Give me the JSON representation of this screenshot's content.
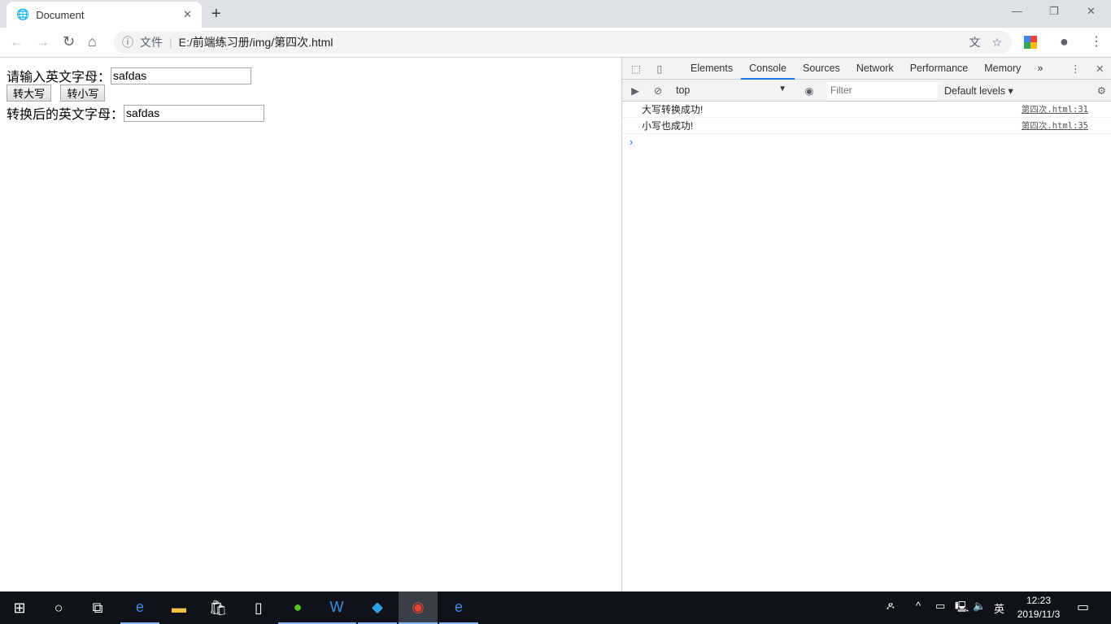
{
  "browser": {
    "tab_title": "Document",
    "url_scheme_label": "文件",
    "url": "E:/前端练习册/img/第四次.html"
  },
  "page": {
    "input_label": "请输入英文字母：",
    "input_value": "safdas",
    "upper_button": "转大写",
    "lower_button": "转小写",
    "output_label": "转换后的英文字母：",
    "output_value": "safdas"
  },
  "devtools": {
    "tabs": [
      "Elements",
      "Console",
      "Sources",
      "Network",
      "Performance",
      "Memory"
    ],
    "active_tab": "Console",
    "context": "top",
    "filter_placeholder": "Filter",
    "levels": "Default levels ▾",
    "messages": [
      {
        "text": "大写转换成功!",
        "source": "第四次.html:31"
      },
      {
        "text": "小写也成功!",
        "source": "第四次.html:35"
      }
    ],
    "prompt": "›"
  },
  "taskbar": {
    "time": "12:23",
    "date": "2019/11/3",
    "ime": "英"
  }
}
